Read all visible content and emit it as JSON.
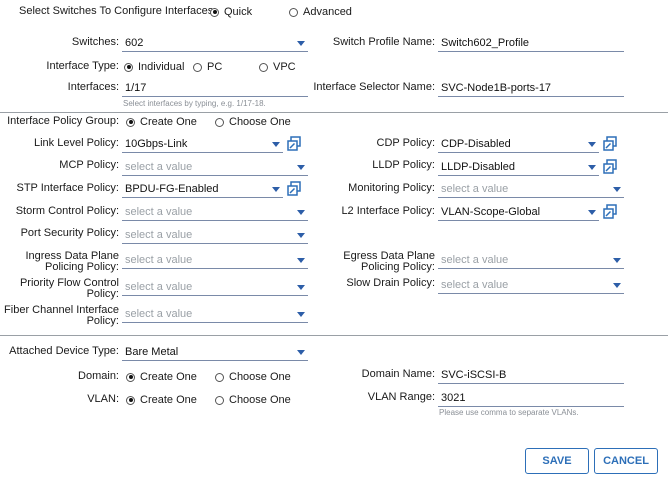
{
  "top": {
    "select_label": "Select Switches To Configure Interfaces:",
    "mode_options": [
      "Quick",
      "Advanced"
    ],
    "mode_selected": "Quick"
  },
  "switches": {
    "label": "Switches:",
    "value": "602"
  },
  "switch_profile": {
    "label": "Switch Profile Name:",
    "value": "Switch602_Profile"
  },
  "interface_type": {
    "label": "Interface Type:",
    "options": [
      "Individual",
      "PC",
      "VPC"
    ],
    "selected": "Individual"
  },
  "interfaces": {
    "label": "Interfaces:",
    "value": "1/17",
    "hint": "Select interfaces by typing, e.g. 1/17-18."
  },
  "interface_selector": {
    "label": "Interface Selector Name:",
    "value": "SVC-Node1B-ports-17"
  },
  "policy_group": {
    "label": "Interface Policy Group:",
    "options": [
      "Create One",
      "Choose One"
    ],
    "selected": "Create One"
  },
  "policies_left": [
    {
      "label": "Link Level Policy:",
      "value": "10Gbps-Link",
      "placeholder": false,
      "edit": true
    },
    {
      "label": "MCP Policy:",
      "value": "select a value",
      "placeholder": true,
      "edit": false
    },
    {
      "label": "STP Interface Policy:",
      "value": "BPDU-FG-Enabled",
      "placeholder": false,
      "edit": true
    },
    {
      "label": "Storm Control Policy:",
      "value": "select a value",
      "placeholder": true,
      "edit": false
    },
    {
      "label": "Port Security Policy:",
      "value": "select a value",
      "placeholder": true,
      "edit": false
    },
    {
      "label": "Ingress Data Plane Policing Policy:",
      "value": "select a value",
      "placeholder": true,
      "edit": false
    },
    {
      "label": "Priority Flow Control Policy:",
      "value": "select a value",
      "placeholder": true,
      "edit": false
    },
    {
      "label": "Fiber Channel Interface Policy:",
      "value": "select a value",
      "placeholder": true,
      "edit": false
    }
  ],
  "policies_right": [
    {
      "label": "CDP Policy:",
      "value": "CDP-Disabled",
      "placeholder": false,
      "edit": true
    },
    {
      "label": "LLDP Policy:",
      "value": "LLDP-Disabled",
      "placeholder": false,
      "edit": true
    },
    {
      "label": "Monitoring Policy:",
      "value": "select a value",
      "placeholder": true,
      "edit": false
    },
    {
      "label": "L2 Interface Policy:",
      "value": "VLAN-Scope-Global",
      "placeholder": false,
      "edit": true
    },
    {
      "label": "Egress Data Plane Policing Policy:",
      "value": "select a value",
      "placeholder": true,
      "edit": false
    },
    {
      "label": "Slow Drain Policy:",
      "value": "select a value",
      "placeholder": true,
      "edit": false
    }
  ],
  "attached": {
    "label": "Attached Device Type:",
    "value": "Bare Metal"
  },
  "domain": {
    "label": "Domain:",
    "options": [
      "Create One",
      "Choose One"
    ],
    "selected": "Create One"
  },
  "domain_name": {
    "label": "Domain Name:",
    "value": "SVC-iSCSI-B"
  },
  "vlan": {
    "label": "VLAN:",
    "options": [
      "Create One",
      "Choose One"
    ],
    "selected": "Create One"
  },
  "vlan_range": {
    "label": "VLAN Range:",
    "value": "3021",
    "hint": "Please use comma to separate VLANs."
  },
  "buttons": {
    "save": "SAVE",
    "cancel": "CANCEL"
  },
  "colors": {
    "accent": "#2d6fb8",
    "caret": "#2d5ea8",
    "placeholder": "#9aa0a6",
    "divider": "#9aa0a6"
  },
  "icons": {
    "edit": "edit-policy-icon",
    "dropdown": "chevron-down-icon"
  }
}
